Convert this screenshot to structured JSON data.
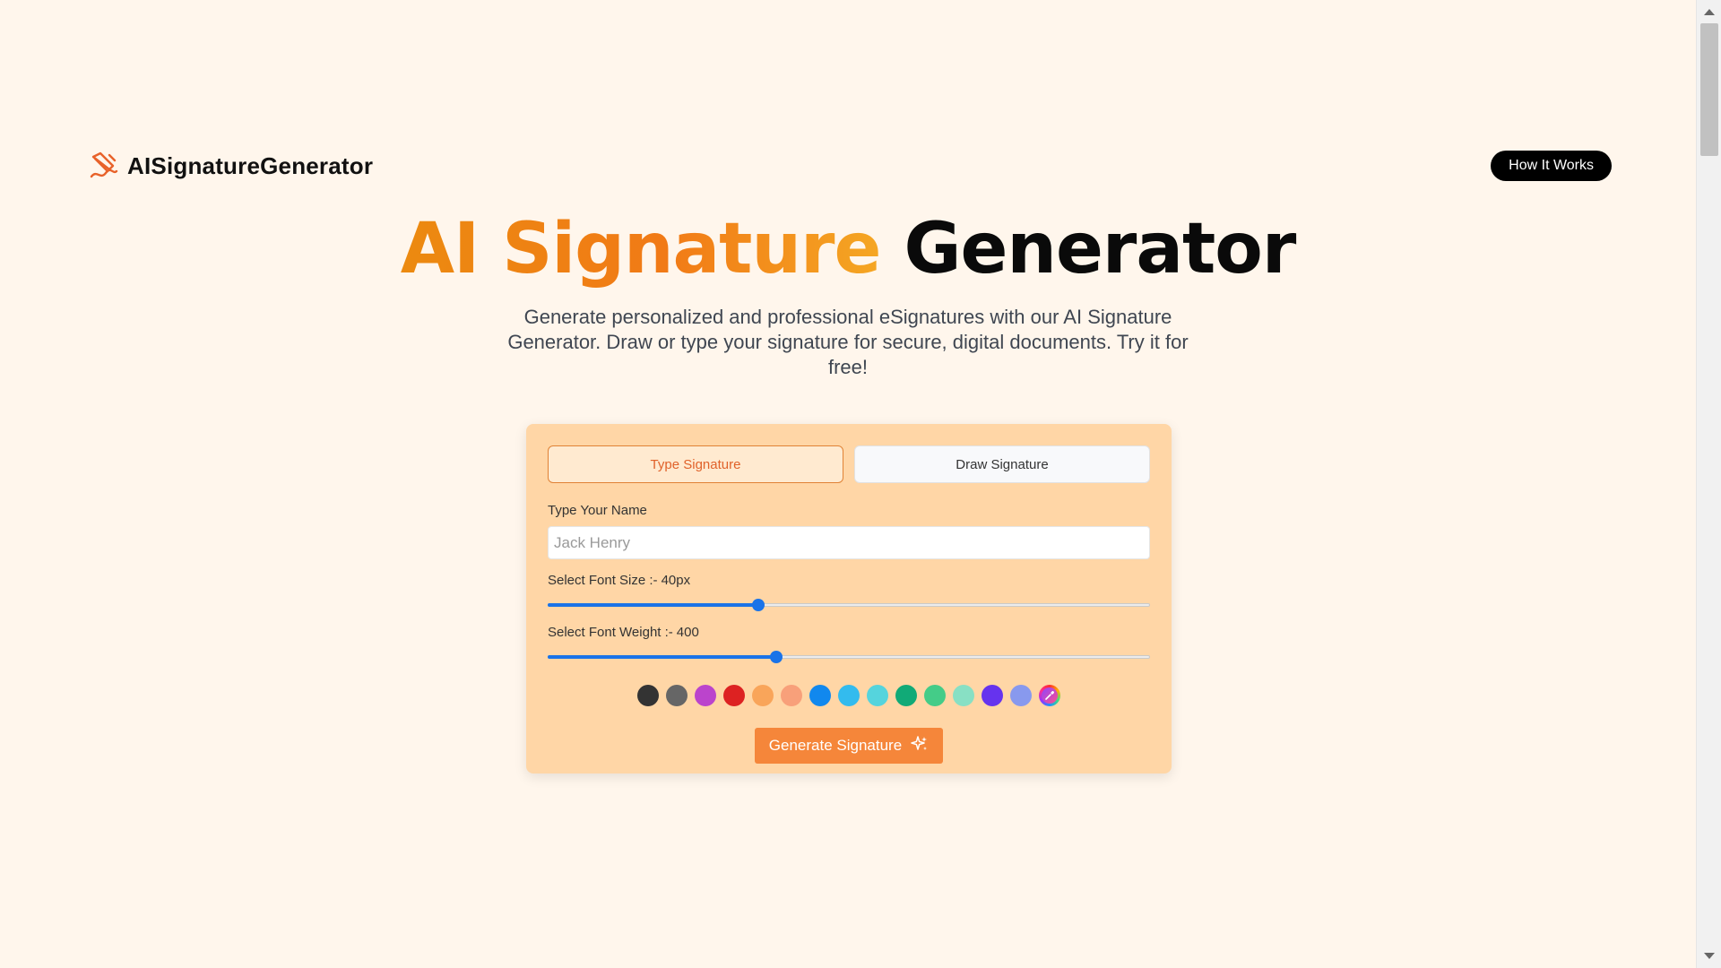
{
  "header": {
    "brand_name": "AISignatureGenerator",
    "how_it_works_label": "How It Works"
  },
  "hero": {
    "title_accent": "AI Signature",
    "title_rest": "Generator",
    "subtitle": "Generate personalized and professional eSignatures with our AI Signature Generator. Draw or type your signature for secure, digital documents. Try it for free!"
  },
  "tabs": {
    "type_label": "Type Signature",
    "draw_label": "Draw Signature",
    "active": "type"
  },
  "name_field": {
    "label": "Type Your Name",
    "placeholder": "Jack Henry",
    "value": ""
  },
  "font_size": {
    "label": "Select Font Size :-",
    "value_text": "40px",
    "level_percent": 35
  },
  "font_weight": {
    "label": "Select Font Weight :-",
    "value_text": "400",
    "level_percent": 38
  },
  "colors": {
    "swatches": [
      "#333333",
      "#666666",
      "#bb44cc",
      "#dd2222",
      "#f9a55a",
      "#f8a07a",
      "#1188ee",
      "#33bbee",
      "#55d4dd",
      "#11aa77",
      "#44cc88",
      "#88e0c4",
      "#6633ee",
      "#8899ee"
    ],
    "picker_icon": "eyedropper-icon"
  },
  "generate": {
    "label": "Generate Signature",
    "icon": "sparkle-icon"
  },
  "brand_colors": {
    "accent": "#f5863a",
    "card": "#ffd6a6",
    "background": "#fff6ec"
  }
}
